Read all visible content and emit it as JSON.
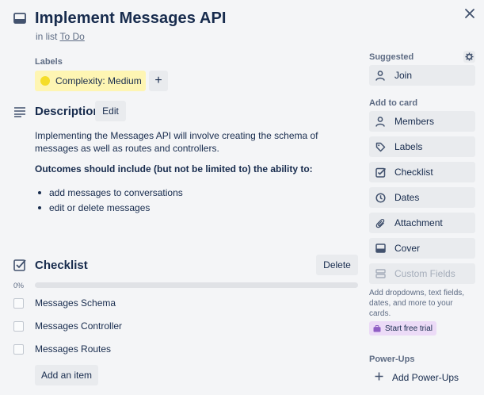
{
  "card": {
    "title": "Implement Messages API",
    "in_list_prefix": "in list",
    "list_name": "To Do"
  },
  "labels": {
    "heading": "Labels",
    "items": [
      {
        "text": "Complexity: Medium",
        "color": "#f5dd29",
        "bg": "#fef5b3"
      }
    ],
    "add_symbol": "+"
  },
  "description": {
    "heading": "Description",
    "edit_label": "Edit",
    "text": "Implementing the Messages API will involve creating the schema of messages as well as routes and controllers.",
    "bold_text": "Outcomes should include (but not be limited to) the ability to:",
    "bullets": [
      "add messages to conversations",
      "edit or delete messages"
    ]
  },
  "checklist": {
    "heading": "Checklist",
    "delete_label": "Delete",
    "progress_text": "0%",
    "progress": 0,
    "items": [
      {
        "text": "Messages Schema",
        "checked": false
      },
      {
        "text": "Messages Controller",
        "checked": false
      },
      {
        "text": "Messages Routes",
        "checked": false
      }
    ],
    "add_item_label": "Add an item"
  },
  "sidebar": {
    "suggested_heading": "Suggested",
    "join_label": "Join",
    "add_to_card_heading": "Add to card",
    "buttons": [
      {
        "label": "Members",
        "icon": "person-icon"
      },
      {
        "label": "Labels",
        "icon": "tag-icon"
      },
      {
        "label": "Checklist",
        "icon": "checkbox-icon"
      },
      {
        "label": "Dates",
        "icon": "clock-icon"
      },
      {
        "label": "Attachment",
        "icon": "paperclip-icon"
      },
      {
        "label": "Cover",
        "icon": "cover-icon"
      },
      {
        "label": "Custom Fields",
        "icon": "custom-fields-icon"
      }
    ],
    "hint": "Add dropdowns, text fields, dates, and more to your cards.",
    "trial_label": "Start free trial",
    "powerups_heading": "Power-Ups",
    "add_powerups_label": "Add Power-Ups"
  },
  "colors": {
    "background": "#f4f5f7",
    "button_bg": "#e9ebee",
    "trial_bg": "#ecdbf7",
    "progress_fill": "#5ba4cf"
  }
}
